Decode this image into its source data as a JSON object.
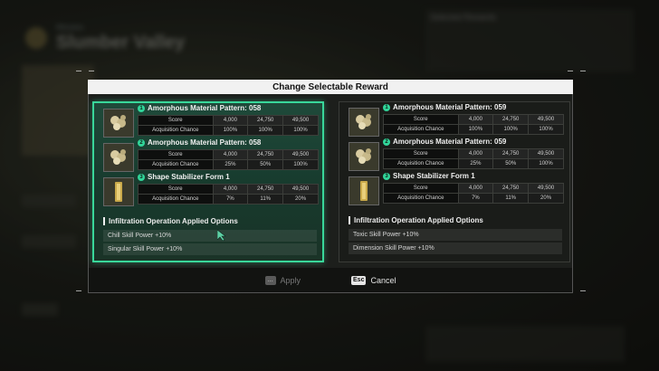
{
  "background": {
    "zone_label": "Mission",
    "zone_title": "Slumber Valley",
    "right_header": "Selected Rewards"
  },
  "modal": {
    "title": "Change Selectable Reward",
    "apply_label": "Apply",
    "apply_key": "…",
    "cancel_label": "Cancel",
    "cancel_key": "Esc"
  },
  "left_panel": {
    "selected": true,
    "rewards": [
      {
        "num": "1",
        "name": "Amorphous Material Pattern: 058",
        "score_label": "Score",
        "chance_label": "Acquisition Chance",
        "scores": [
          "4,000",
          "24,750",
          "49,500"
        ],
        "chances": [
          "100%",
          "100%",
          "100%"
        ],
        "icon": "amorphous-material-icon"
      },
      {
        "num": "2",
        "name": "Amorphous Material Pattern: 058",
        "score_label": "Score",
        "chance_label": "Acquisition Chance",
        "scores": [
          "4,000",
          "24,750",
          "49,500"
        ],
        "chances": [
          "25%",
          "50%",
          "100%"
        ],
        "icon": "amorphous-material-icon"
      },
      {
        "num": "3",
        "name": "Shape Stabilizer Form 1",
        "score_label": "Score",
        "chance_label": "Acquisition Chance",
        "scores": [
          "4,000",
          "24,750",
          "49,500"
        ],
        "chances": [
          "7%",
          "11%",
          "20%"
        ],
        "icon": "shape-stabilizer-icon"
      }
    ],
    "options_title": "Infiltration Operation Applied Options",
    "options": [
      "Chill Skill Power +10%",
      "Singular Skill Power +10%"
    ]
  },
  "right_panel": {
    "selected": false,
    "rewards": [
      {
        "num": "1",
        "name": "Amorphous Material Pattern: 059",
        "score_label": "Score",
        "chance_label": "Acquisition Chance",
        "scores": [
          "4,000",
          "24,750",
          "49,500"
        ],
        "chances": [
          "100%",
          "100%",
          "100%"
        ],
        "icon": "amorphous-material-icon"
      },
      {
        "num": "2",
        "name": "Amorphous Material Pattern: 059",
        "score_label": "Score",
        "chance_label": "Acquisition Chance",
        "scores": [
          "4,000",
          "24,750",
          "49,500"
        ],
        "chances": [
          "25%",
          "50%",
          "100%"
        ],
        "icon": "amorphous-material-icon"
      },
      {
        "num": "3",
        "name": "Shape Stabilizer Form 1",
        "score_label": "Score",
        "chance_label": "Acquisition Chance",
        "scores": [
          "4,000",
          "24,750",
          "49,500"
        ],
        "chances": [
          "7%",
          "11%",
          "20%"
        ],
        "icon": "shape-stabilizer-icon"
      }
    ],
    "options_title": "Infiltration Operation Applied Options",
    "options": [
      "Toxic Skill Power +10%",
      "Dimension Skill Power +10%"
    ]
  },
  "colors": {
    "accent": "#39d79a",
    "badge": "#31d69a",
    "title_bar": "#f1f1f1"
  }
}
